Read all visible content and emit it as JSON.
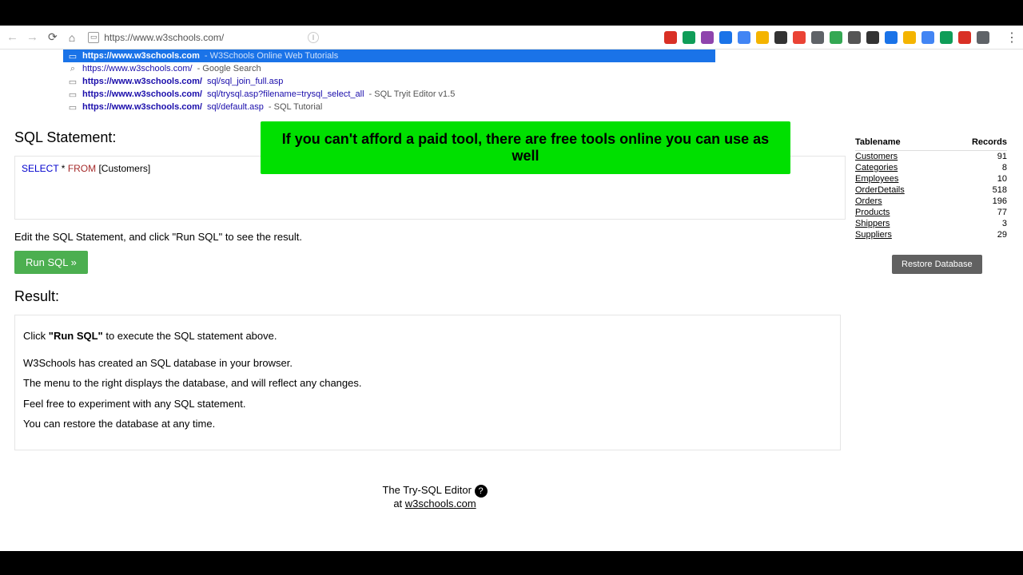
{
  "url": "https://www.w3schools.com/",
  "suggestions": [
    {
      "sel": true,
      "icon": "▭",
      "url": "https://www.w3schools.com",
      "sep": " - ",
      "desc": "W3Schools Online Web Tutorials",
      "bold": true
    },
    {
      "sel": false,
      "icon": "⌕",
      "url": "https://www.w3schools.com/",
      "sep": " - ",
      "desc": "Google Search",
      "bold": false
    },
    {
      "sel": false,
      "icon": "▭",
      "url": "https://www.w3schools.com/",
      "path": "sql/sql_join_full.asp",
      "sep": "",
      "desc": "",
      "bold": true
    },
    {
      "sel": false,
      "icon": "▭",
      "url": "https://www.w3schools.com/",
      "path": "sql/trysql.asp?filename=trysql_select_all",
      "sep": " - ",
      "desc": "SQL Tryit Editor v1.5",
      "bold": true
    },
    {
      "sel": false,
      "icon": "▭",
      "url": "https://www.w3schools.com/",
      "path": "sql/default.asp",
      "sep": " - ",
      "desc": "SQL Tutorial",
      "bold": true
    }
  ],
  "caption": "If you can't afford a paid tool, there are free tools online you can use as well",
  "stmt_label": "SQL Statement:",
  "sql_kw1": "SELECT",
  "sql_star": " * ",
  "sql_kw2": "FROM",
  "sql_rest": " [Customers]",
  "edit_hint": "Edit the SQL Statement, and click \"Run SQL\" to see the result.",
  "run_label": "Run SQL »",
  "result_label": "Result:",
  "result_lines": {
    "l1a": "Click ",
    "l1b": "\"Run SQL\"",
    "l1c": " to execute the SQL statement above.",
    "l2": "W3Schools has created an SQL database in your browser.",
    "l3": "The menu to the right displays the database, and will reflect any changes.",
    "l4": "Feel free to experiment with any SQL statement.",
    "l5": "You can restore the database at any time."
  },
  "tablename_hdr": "Tablename",
  "records_hdr": "Records",
  "tables": [
    {
      "name": "Customers",
      "count": 91
    },
    {
      "name": "Categories",
      "count": 8
    },
    {
      "name": "Employees",
      "count": 10
    },
    {
      "name": "OrderDetails",
      "count": 518
    },
    {
      "name": "Orders",
      "count": 196
    },
    {
      "name": "Products",
      "count": 77
    },
    {
      "name": "Shippers",
      "count": 3
    },
    {
      "name": "Suppliers",
      "count": 29
    }
  ],
  "restore_label": "Restore Database",
  "footer1": "The Try-SQL Editor ",
  "footer2": "at ",
  "footer_link": "w3schools.com",
  "ext_colors": [
    "#d93025",
    "#0f9d58",
    "#8e44ad",
    "#1a73e8",
    "#4285f4",
    "#f4b400",
    "#333",
    "#ea4335",
    "#5f6368",
    "#34a853",
    "#555",
    "#333",
    "#1a73e8",
    "#f4b400",
    "#4285f4",
    "#0f9d58",
    "#d93025",
    "#5f6368"
  ]
}
